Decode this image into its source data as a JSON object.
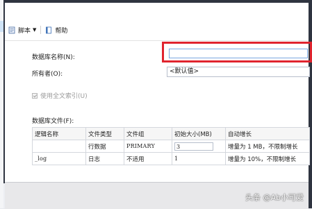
{
  "toolbar": {
    "script_label": "脚本",
    "help_label": "帮助"
  },
  "form": {
    "db_name_label": "数据库名称(N):",
    "db_name_value": "",
    "owner_label": "所有者(O):",
    "owner_value": "<默认值>",
    "fulltext_label": "使用全文索引(U)",
    "files_label": "数据库文件(F):"
  },
  "files_table": {
    "headers": [
      "逻辑名称",
      "文件类型",
      "文件组",
      "初始大小(MB)",
      "自动增长"
    ],
    "rows": [
      [
        "",
        "行数据",
        "PRIMARY",
        "3",
        "增量为 1 MB，不限制增长"
      ],
      [
        "_log",
        "日志",
        "不适用",
        "1",
        "增量为 10%，不限制增长"
      ]
    ]
  },
  "watermark": "头条 @Ab小可爱",
  "colors": {
    "highlight_border": "#e0242e",
    "dark_frame": "#2f3440"
  }
}
